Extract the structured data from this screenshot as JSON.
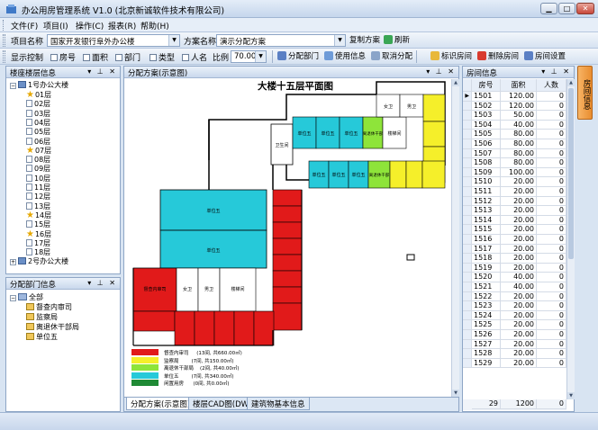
{
  "window": {
    "title": "办公用房管理系统  V1.0   (北京新诚软件技术有限公司)"
  },
  "menu": [
    {
      "label": "文件(F)"
    },
    {
      "label": "项目(I)"
    },
    {
      "label": "操作(C)"
    },
    {
      "label": "报表(R)"
    },
    {
      "label": "帮助(H)"
    }
  ],
  "toolbar1": {
    "project_label": "项目名称",
    "project_value": "国家开发银行阜外办公楼",
    "scheme_label": "方案名称",
    "scheme_value": "演示分配方案",
    "copy_label": "复制方案",
    "refresh_label": "刷新"
  },
  "toolbar2": {
    "display_label": "显示控制",
    "room_no": "房号",
    "area": "面积",
    "dept": "部门",
    "type": "类型",
    "person": "人名",
    "scale_label": "比例",
    "scale_value": "70.00",
    "assign_dept": "分配部门",
    "use_info": "使用信息",
    "cancel_assign": "取消分配",
    "mark_room": "标识房间",
    "delete_room": "删除房间",
    "room_settings": "房间设置"
  },
  "floor_panel": {
    "title": "楼座楼层信息",
    "buildings": [
      {
        "label": "1号办公大楼"
      },
      {
        "label": "2号办公大楼"
      }
    ],
    "floors": [
      {
        "label": "01层",
        "icon": "star"
      },
      {
        "label": "02层",
        "icon": "doc"
      },
      {
        "label": "03层",
        "icon": "doc"
      },
      {
        "label": "04层",
        "icon": "doc"
      },
      {
        "label": "05层",
        "icon": "doc"
      },
      {
        "label": "06层",
        "icon": "doc"
      },
      {
        "label": "07层",
        "icon": "star"
      },
      {
        "label": "08层",
        "icon": "doc"
      },
      {
        "label": "09层",
        "icon": "doc"
      },
      {
        "label": "10层",
        "icon": "doc"
      },
      {
        "label": "11层",
        "icon": "doc"
      },
      {
        "label": "12层",
        "icon": "doc"
      },
      {
        "label": "13层",
        "icon": "doc"
      },
      {
        "label": "14层",
        "icon": "star"
      },
      {
        "label": "15层",
        "icon": "doc"
      },
      {
        "label": "16层",
        "icon": "star"
      },
      {
        "label": "17层",
        "icon": "doc"
      },
      {
        "label": "18层",
        "icon": "doc"
      }
    ]
  },
  "dept_panel": {
    "title": "分配部门信息",
    "root": "全部",
    "items": [
      {
        "label": "督查内审司"
      },
      {
        "label": "监察局"
      },
      {
        "label": "离退休干部局"
      },
      {
        "label": "单位五"
      }
    ]
  },
  "center": {
    "title": "分配方案(示意图)",
    "plan_title": "大楼十五层平面图",
    "tabs": [
      {
        "label": "分配方案(示意图)"
      },
      {
        "label": "楼层CAD图(DWF)"
      },
      {
        "label": "建筑物基本信息"
      }
    ],
    "rooms": {
      "wc": "卫生间",
      "women": "女卫",
      "men": "男卫",
      "stairs": "楼梯间",
      "office": "单位五",
      "retired": "离退休干部",
      "inspect": "督查内审司",
      "elevator_hall": "电梯厅"
    },
    "legend": [
      {
        "color": "#e11a1a",
        "text": "督查内审司     (13间, 共660.00㎡)"
      },
      {
        "color": "#f5ef2a",
        "text": "监察局        (7间, 共150.00㎡)"
      },
      {
        "color": "#8ee43a",
        "text": "离退休干部局    (2间, 共40.00㎡)"
      },
      {
        "color": "#26c9d9",
        "text": "单位五        (7间, 共340.00㎡)"
      },
      {
        "color": "#1f8a35",
        "text": "闲置用房      (0间, 共0.00㎡)"
      }
    ]
  },
  "room_panel": {
    "title": "房间信息",
    "headers": [
      "房号",
      "面积",
      "人数"
    ],
    "rows": [
      [
        "1501",
        "120.00",
        "0"
      ],
      [
        "1502",
        "120.00",
        "0"
      ],
      [
        "1503",
        "50.00",
        "0"
      ],
      [
        "1504",
        "40.00",
        "0"
      ],
      [
        "1505",
        "80.00",
        "0"
      ],
      [
        "1506",
        "80.00",
        "0"
      ],
      [
        "1507",
        "80.00",
        "0"
      ],
      [
        "1508",
        "80.00",
        "0"
      ],
      [
        "1509",
        "100.00",
        "0"
      ],
      [
        "1510",
        "20.00",
        "0"
      ],
      [
        "1511",
        "20.00",
        "0"
      ],
      [
        "1512",
        "20.00",
        "0"
      ],
      [
        "1513",
        "20.00",
        "0"
      ],
      [
        "1514",
        "20.00",
        "0"
      ],
      [
        "1515",
        "20.00",
        "0"
      ],
      [
        "1516",
        "20.00",
        "0"
      ],
      [
        "1517",
        "20.00",
        "0"
      ],
      [
        "1518",
        "20.00",
        "0"
      ],
      [
        "1519",
        "20.00",
        "0"
      ],
      [
        "1520",
        "40.00",
        "0"
      ],
      [
        "1521",
        "40.00",
        "0"
      ],
      [
        "1522",
        "20.00",
        "0"
      ],
      [
        "1523",
        "20.00",
        "0"
      ],
      [
        "1524",
        "20.00",
        "0"
      ],
      [
        "1525",
        "20.00",
        "0"
      ],
      [
        "1526",
        "20.00",
        "0"
      ],
      [
        "1527",
        "20.00",
        "0"
      ],
      [
        "1528",
        "20.00",
        "0"
      ],
      [
        "1529",
        "20.00",
        "0"
      ]
    ],
    "footer": [
      "29",
      "1200",
      "0"
    ]
  },
  "side_tab": {
    "label": "房间信息"
  }
}
